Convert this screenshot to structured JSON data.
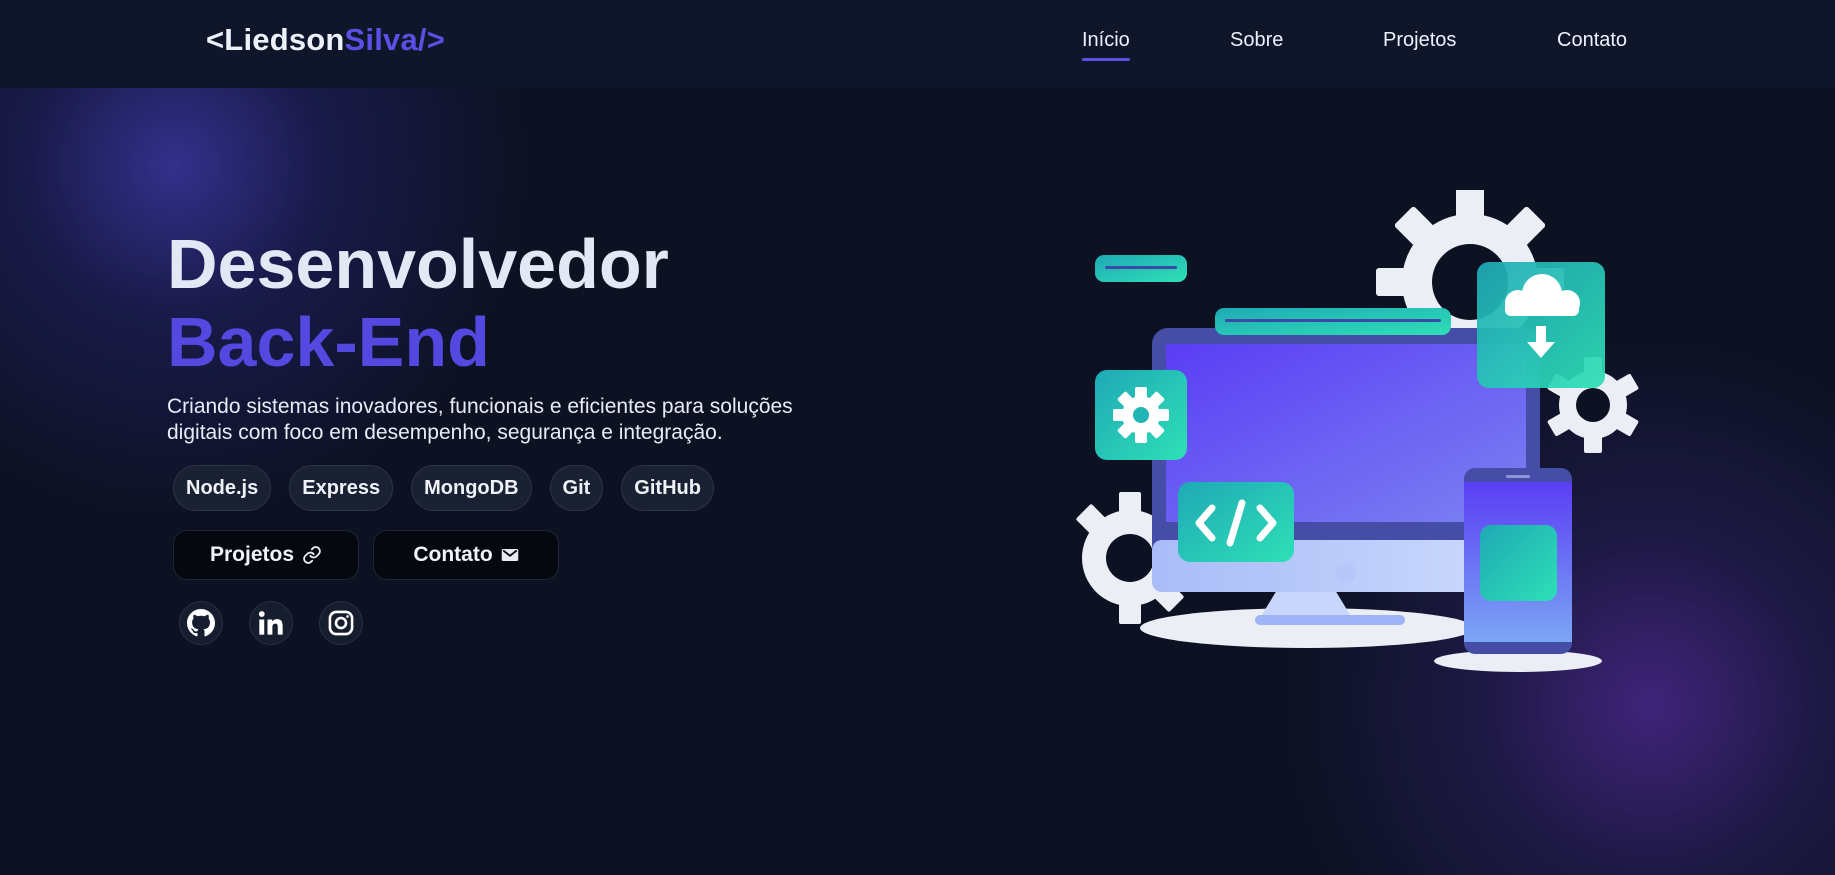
{
  "logo": {
    "open": "<Liedson",
    "accent": "Silva/>"
  },
  "nav": {
    "items": [
      {
        "label": "Início",
        "active": true
      },
      {
        "label": "Sobre",
        "active": false
      },
      {
        "label": "Projetos",
        "active": false
      },
      {
        "label": "Contato",
        "active": false
      }
    ]
  },
  "hero": {
    "title_line1": "Desenvolvedor",
    "title_line2": "Back-End",
    "subtitle_line1": "Criando sistemas inovadores, funcionais e eficientes para soluções",
    "subtitle_line2": "digitais com foco em desempenho, segurança e integração."
  },
  "skills": [
    "Node.js",
    "Express",
    "MongoDB",
    "Git",
    "GitHub"
  ],
  "buttons": {
    "projects": {
      "label": "Projetos",
      "icon": "link-icon"
    },
    "contact": {
      "label": "Contato",
      "icon": "envelope-icon"
    }
  },
  "socials": [
    {
      "name": "github-icon"
    },
    {
      "name": "linkedin-icon"
    },
    {
      "name": "instagram-icon"
    }
  ],
  "colors": {
    "background": "#0c1222",
    "navbar": "#0f1629",
    "accent": "#5b4fe6",
    "teal": "#2dd4bf",
    "chip": "#1a2133"
  }
}
